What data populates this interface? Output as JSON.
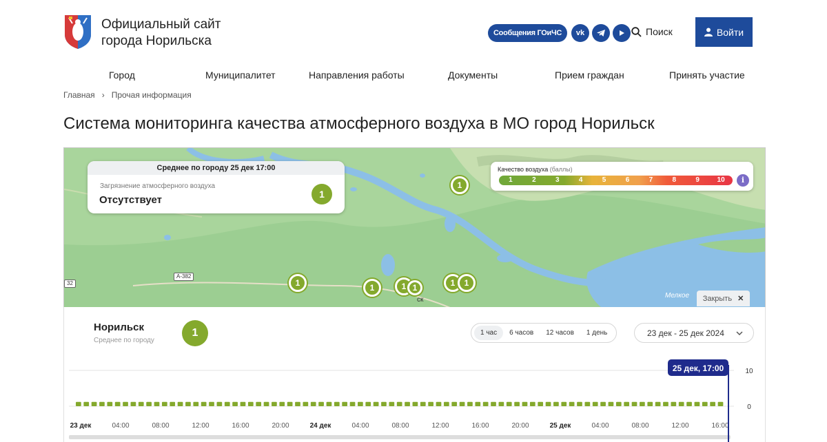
{
  "header": {
    "title_line1": "Официальный сайт",
    "title_line2": "города Норильска",
    "gochs_label": "Сообщения ГОиЧС",
    "search_label": "Поиск",
    "login_label": "Войти",
    "brand_color": "#1e4b9b"
  },
  "nav": {
    "items": [
      "Город",
      "Муниципалитет",
      "Направления работы",
      "Документы",
      "Прием граждан",
      "Принять участие"
    ]
  },
  "breadcrumb": {
    "home": "Главная",
    "separator": "›",
    "current": "Прочая информация"
  },
  "page_title": "Система мониторинга качества атмосферного воздуха в МО город Норильск",
  "map": {
    "avg_card": {
      "heading": "Среднее по городу 25 дек 17:00",
      "label": "Загрязнение атмосферного воздуха",
      "value": "Отсутствует",
      "index": "1"
    },
    "scale": {
      "title": "Качество воздуха",
      "unit": "(баллы)",
      "levels": [
        "1",
        "2",
        "3",
        "4",
        "5",
        "6",
        "7",
        "8",
        "9",
        "10"
      ]
    },
    "close_label": "Закрыть",
    "pins": [
      "1",
      "1",
      "1",
      "1",
      "1",
      "1",
      "1"
    ],
    "road_label": "А-382",
    "road_label_edge": "32",
    "lake_label": "Мелкое",
    "city_fragment": "ск"
  },
  "panel": {
    "city": "Норильск",
    "city_sub": "Среднее по городу",
    "city_index": "1",
    "periods": [
      "1 час",
      "6 часов",
      "12 часов",
      "1 день"
    ],
    "active_period": "1 час",
    "date_range": "23 дек - 25 дек 2024"
  },
  "chart_data": {
    "type": "bar",
    "tooltip": "25 дек, 17:00",
    "y_ticks": [
      "10",
      "0"
    ],
    "ylim": [
      0,
      10
    ],
    "x_tick_labels": [
      "23 дек",
      "04:00",
      "08:00",
      "12:00",
      "16:00",
      "20:00",
      "24 дек",
      "04:00",
      "08:00",
      "12:00",
      "16:00",
      "20:00",
      "25 дек",
      "04:00",
      "08:00",
      "12:00",
      "16:00"
    ],
    "bar_count": 83,
    "values_all": 1,
    "bar_color": "#84a92d",
    "cursor_color": "#1f2b8c"
  }
}
